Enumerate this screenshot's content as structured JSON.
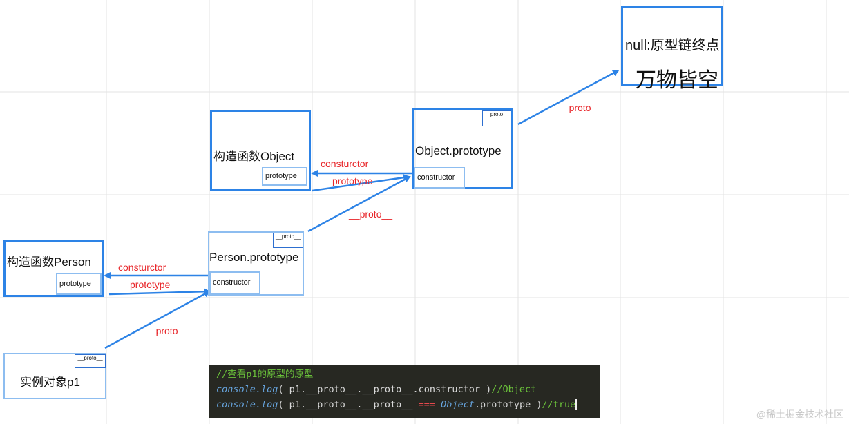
{
  "nodes": {
    "null_box": {
      "title": "null:原型链终点",
      "subtitle": "万物皆空"
    },
    "object_ctor": {
      "title": "构造函数Object",
      "prototype_tag": "prototype"
    },
    "object_proto": {
      "title": "Object.prototype",
      "proto_tag": "__proto__",
      "constructor_tag": "constructor"
    },
    "person_ctor": {
      "title": "构造函数Person",
      "prototype_tag": "prototype"
    },
    "person_proto": {
      "title": "Person.prototype",
      "proto_tag": "__proto__",
      "constructor_tag": "constructor"
    },
    "instance": {
      "title": "实例对象p1",
      "proto_tag": "__proto__"
    }
  },
  "edges": {
    "object_proto_to_null": "__proto__",
    "object_constructor": "consturctor",
    "object_prototype": "prototype",
    "person_proto_to_object_proto": "__proto__",
    "person_constructor": "consturctor",
    "person_prototype": "prototype",
    "instance_to_person_proto": "__proto__"
  },
  "code": {
    "comment": "//查看p1的原型的原型",
    "line1": {
      "fn": "console.log",
      "body": "( p1.__proto__.__proto__.constructor )",
      "comment": "//Object"
    },
    "line2": {
      "fn": "console.log",
      "body_a": "( p1.__proto__.__proto__ ",
      "op": "===",
      "obj": "Object",
      "body_b": ".prototype )",
      "comment": "//true"
    }
  },
  "watermark": "@稀土掘金技术社区",
  "colors": {
    "box_border": "#2d83e6",
    "box_border_light": "#8dbdf0",
    "arrow": "#2d83e6",
    "label": "#e8262a",
    "code_bg": "#272822"
  }
}
